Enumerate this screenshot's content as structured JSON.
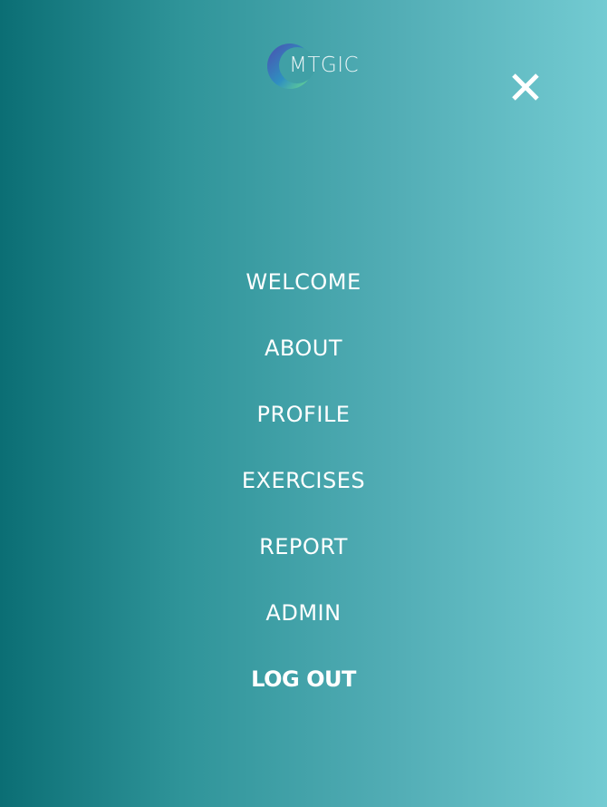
{
  "header": {
    "logo_text": "MTGIC",
    "logo_icon": "crescent-logo-icon",
    "close_icon": "close-icon"
  },
  "nav": {
    "items": [
      {
        "label": "WELCOME"
      },
      {
        "label": "ABOUT"
      },
      {
        "label": "PROFILE"
      },
      {
        "label": "EXERCISES"
      },
      {
        "label": "REPORT"
      },
      {
        "label": "ADMIN"
      },
      {
        "label": "LOG OUT"
      }
    ]
  },
  "colors": {
    "gradient_start": "#0b6e74",
    "gradient_end": "#73cbd2",
    "text": "#ffffff"
  }
}
